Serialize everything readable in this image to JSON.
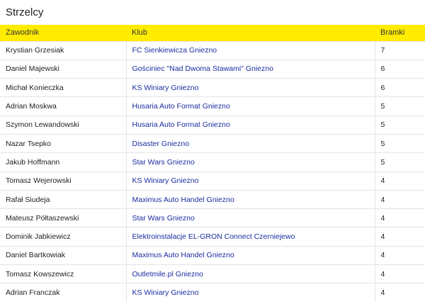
{
  "panel": {
    "title": "Strzelcy"
  },
  "table": {
    "headers": {
      "player": "Zawodnik",
      "club": "Klub",
      "goals": "Bramki"
    },
    "rows": [
      {
        "player": "Krystian Grzesiak",
        "club": "FC Sienkiewicza Gniezno",
        "goals": "7"
      },
      {
        "player": "Daniel Majewski",
        "club": "Gościniec \"Nad Dwoma Stawami\" Gniezno",
        "goals": "6"
      },
      {
        "player": "Michał Konieczka",
        "club": "KS Winiary Gniezno",
        "goals": "6"
      },
      {
        "player": "Adrian Moskwa",
        "club": "Husaria Auto Format Gniezno",
        "goals": "5"
      },
      {
        "player": "Szymon Lewandowski",
        "club": "Husaria Auto Format Gniezno",
        "goals": "5"
      },
      {
        "player": "Nazar Tsepko",
        "club": "Disaster Gniezno",
        "goals": "5"
      },
      {
        "player": "Jakub Hoffmann",
        "club": "Star Wars Gniezno",
        "goals": "5"
      },
      {
        "player": "Tomasz Wejerowski",
        "club": "KS Winiary Gniezno",
        "goals": "4"
      },
      {
        "player": "Rafał Siudeja",
        "club": "Maximus Auto Handel Gniezno",
        "goals": "4"
      },
      {
        "player": "Mateusz Półtaszewski",
        "club": "Star Wars Gniezno",
        "goals": "4"
      },
      {
        "player": "Dominik Jabkiewicz",
        "club": "Elektroinstalacje EL-GRON Connect Czerniejewo",
        "goals": "4"
      },
      {
        "player": "Daniel Bartkowiak",
        "club": "Maximus Auto Handel Gniezno",
        "goals": "4"
      },
      {
        "player": "Tomasz Kowszewicz",
        "club": "Outletmile.pl Gniezno",
        "goals": "4"
      },
      {
        "player": "Adrian Franczak",
        "club": "KS Winiary Gniezno",
        "goals": "4"
      }
    ]
  },
  "colors": {
    "header_background": "#ffec00",
    "club_link": "#1a2c9e"
  }
}
